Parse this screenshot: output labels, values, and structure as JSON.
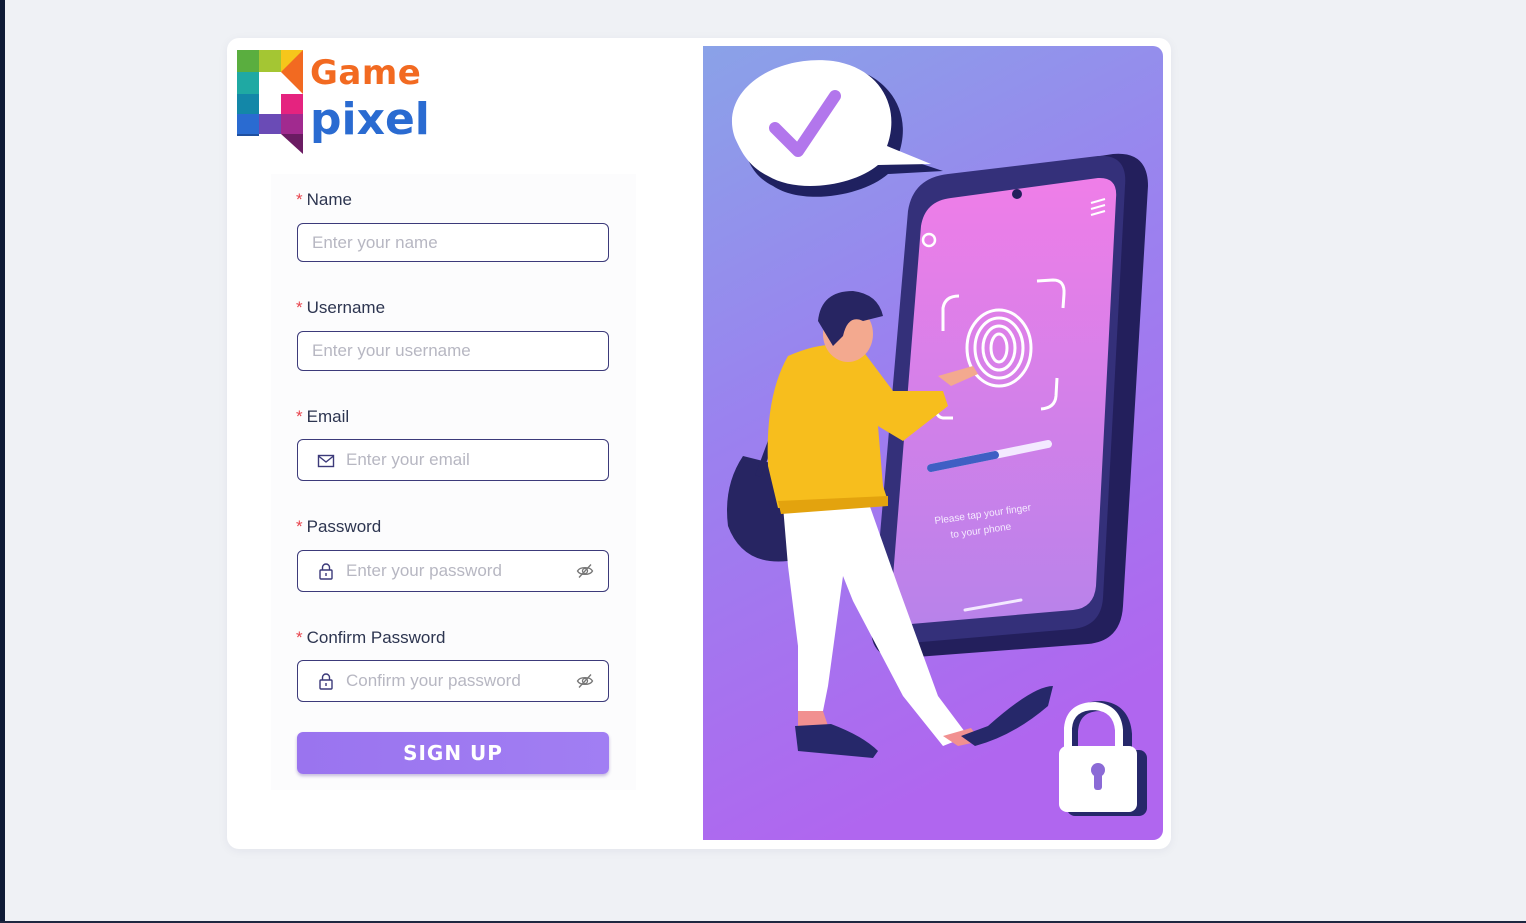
{
  "logo": {
    "line1": "Game",
    "line2": "pixel"
  },
  "form": {
    "required_mark": "*",
    "name": {
      "label": "Name",
      "placeholder": "Enter your name"
    },
    "username": {
      "label": "Username",
      "placeholder": "Enter your username"
    },
    "email": {
      "label": "Email",
      "placeholder": "Enter your email",
      "icon": "mail-icon"
    },
    "password": {
      "label": "Password",
      "placeholder": "Enter your password",
      "icon": "lock-icon",
      "toggle_icon": "eye-off-icon"
    },
    "confirm_password": {
      "label": "Confirm Password",
      "placeholder": "Confirm your password",
      "icon": "lock-icon",
      "toggle_icon": "eye-off-icon"
    },
    "submit_label": "SIGN UP"
  },
  "illustration": {
    "phone_caption_line1": "Please tap your finger",
    "phone_caption_line2": "to your phone"
  },
  "colors": {
    "accent": "#9a74ef",
    "input_border": "#3c3a7a",
    "required": "#e8434c",
    "logo_orange": "#f26a21",
    "logo_blue": "#2a6bd1"
  }
}
